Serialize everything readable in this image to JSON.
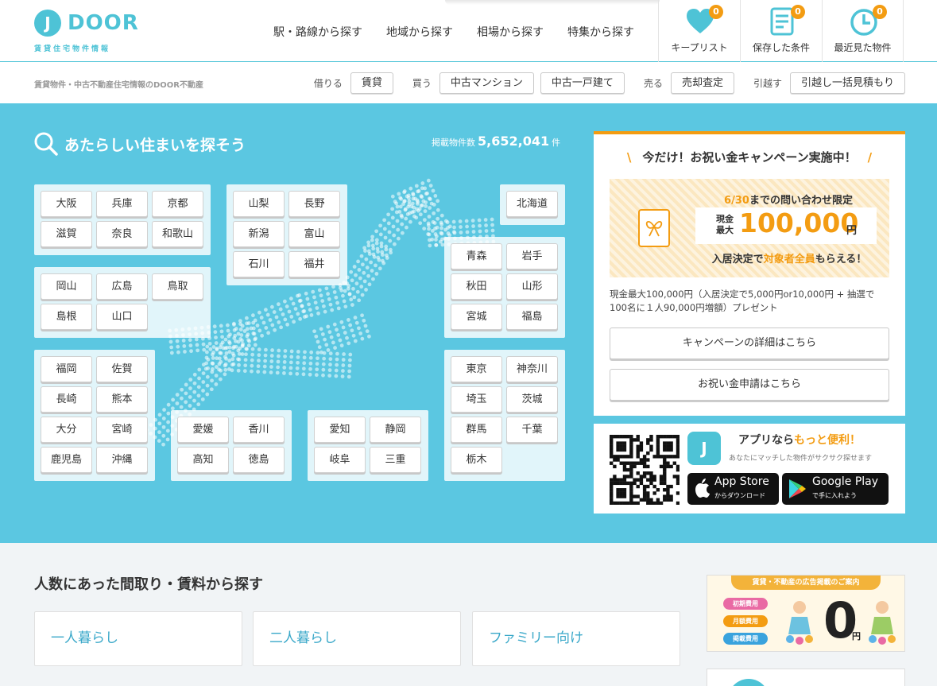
{
  "brand": {
    "logo_mark": "J",
    "logo_text": "DOOR",
    "logo_sub": "賃貸住宅物件情報",
    "tagline": "賃貸物件・中古不動産住宅情報のDOOR不動産"
  },
  "main_nav": [
    "駅・路線から探す",
    "地域から探す",
    "相場から探す",
    "特集から探す"
  ],
  "header_icons": [
    {
      "label": "キープリスト",
      "count": "0",
      "icon": "heart-icon"
    },
    {
      "label": "保存した条件",
      "count": "0",
      "icon": "document-icon"
    },
    {
      "label": "最近見た物件",
      "count": "0",
      "icon": "clock-icon"
    }
  ],
  "categories": [
    {
      "label": "借りる",
      "buttons": [
        "賃貸"
      ]
    },
    {
      "label": "買う",
      "buttons": [
        "中古マンション",
        "中古一戸建て"
      ]
    },
    {
      "label": "売る",
      "buttons": [
        "売却査定"
      ]
    },
    {
      "label": "引越す",
      "buttons": [
        "引越し一括見積もり"
      ]
    }
  ],
  "search": {
    "title": "あたらしい住まいを探そう",
    "count_label": "掲載物件数",
    "count": "5,652,041",
    "count_unit": "件"
  },
  "regions": {
    "kansai": [
      "大阪",
      "兵庫",
      "京都",
      "滋賀",
      "奈良",
      "和歌山"
    ],
    "chubu": [
      "山梨",
      "長野",
      "新潟",
      "富山",
      "石川",
      "福井"
    ],
    "hokkaido": [
      "北海道"
    ],
    "chugoku": [
      "岡山",
      "広島",
      "鳥取",
      "島根",
      "山口"
    ],
    "tohoku": [
      "青森",
      "岩手",
      "秋田",
      "山形",
      "宮城",
      "福島"
    ],
    "kyushu": [
      "福岡",
      "佐賀",
      "長崎",
      "熊本",
      "大分",
      "宮崎",
      "鹿児島",
      "沖縄"
    ],
    "shikoku": [
      "愛媛",
      "香川",
      "高知",
      "徳島"
    ],
    "tokai": [
      "愛知",
      "静岡",
      "岐阜",
      "三重"
    ],
    "kanto": [
      "東京",
      "神奈川",
      "埼玉",
      "茨城",
      "群馬",
      "千葉",
      "栃木"
    ]
  },
  "campaign": {
    "headline": "今だけ！お祝い金キャンペーン実施中！",
    "slash_left": "\\",
    "slash_right": "/",
    "limit_date": "6/30",
    "limit_text": "までの問い合わせ限定",
    "amount_prefix_1": "現金",
    "amount_prefix_2": "最大",
    "amount": "100,000",
    "amount_unit": "円",
    "bottom_pre": "入居決定で",
    "bottom_hl": "対象者全員",
    "bottom_post": "もらえる！",
    "note": "現金最大100,000円（入居決定で5,000円or10,000円 + 抽選で100名に１人90,000円増額）プレゼント",
    "details_button": "キャンペーンの詳細はこちら",
    "apply_button": "お祝い金申請はこちら"
  },
  "app": {
    "title_pre": "アプリなら",
    "title_hl": "もっと便利！",
    "subtitle": "あなたにマッチした物件がサクサク探せます",
    "appstore_main": "App Store",
    "appstore_sub": "からダウンロード",
    "googleplay_main": "Google Play",
    "googleplay_sub": "で手に入れよう"
  },
  "lifestyle": {
    "title": "人数にあった間取り・賃料から探す",
    "cards": [
      "一人暮らし",
      "二人暮らし",
      "ファミリー向け"
    ]
  },
  "ad": {
    "top": "賃貸・不動産の広告掲載のご案内",
    "pills": [
      "初期費用",
      "月額費用",
      "掲載費用"
    ],
    "zero": "0",
    "yen": "円"
  },
  "colors": {
    "accent": "#4ec3d6",
    "hero_bg": "#5bc7e1",
    "orange": "#f39c12"
  }
}
